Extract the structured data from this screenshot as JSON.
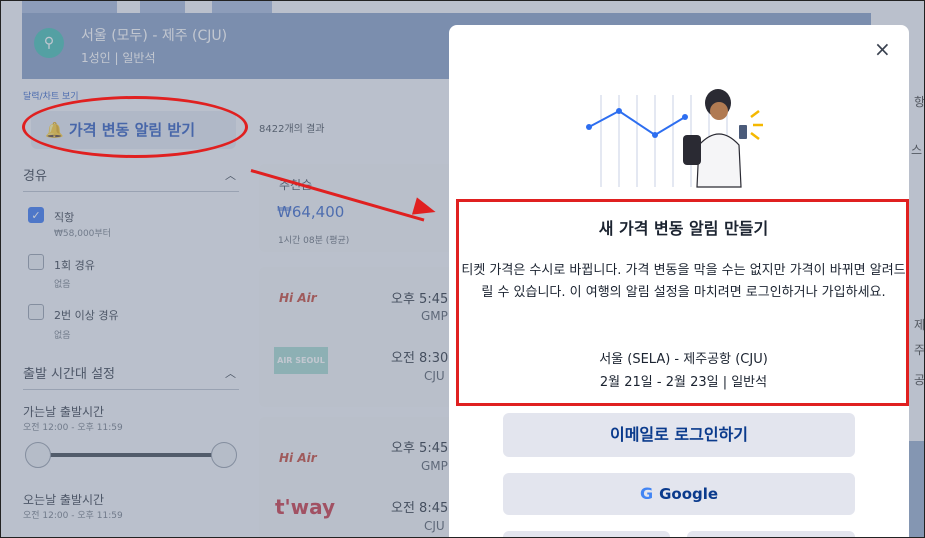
{
  "search": {
    "route": "서울 (모두) - 제주 (CJU)",
    "pax": "1성인 | 일반석",
    "calendar_link": "달력/차트 보기",
    "price_alert_button": "가격 변동 알림 받기",
    "results_count": "8422개의 결과"
  },
  "filters": {
    "stops_heading": "경유",
    "options": [
      {
        "label": "직항",
        "sub": "₩58,000부터",
        "checked": true
      },
      {
        "label": "1회 경유",
        "sub": "없음",
        "checked": false
      },
      {
        "label": "2번 이상 경유",
        "sub": "없음",
        "checked": false
      }
    ],
    "time_heading": "출발 시간대 설정",
    "outbound_label": "가는날 출발시간",
    "outbound_range": "오전 12:00 - 오후 11:59",
    "return_label": "오는날 출발시간",
    "return_range": "오전 12:00 - 오후 11:59"
  },
  "results": {
    "recommended_label": "추천순",
    "recommended_price": "₩64,400",
    "recommended_sub": "1시간 08분 (평균)",
    "cards": [
      {
        "airline1": "Hi Air",
        "time1": "오후 5:45",
        "ap1": "GMP",
        "airline2": "AIR SEOUL",
        "time2": "오전 8:30",
        "ap2": "CJU"
      },
      {
        "airline1": "Hi Air",
        "time1": "오후 5:45",
        "ap1": "GMP",
        "airline2": "t'way",
        "time2": "오전 8:45",
        "ap2": "CJU"
      }
    ]
  },
  "right_strip": {
    "t1": "항",
    "t2": "스",
    "t3": "제",
    "t4": "주",
    "t5": "공"
  },
  "modal": {
    "title": "새 가격 변동 알림 만들기",
    "body": "티켓 가격은 수시로 바뀝니다. 가격 변동을 막을 수는 없지만 가격이 바뀌면 알려드릴 수 있습니다. 이 여행의 알림 설정을 마치려면 로그인하거나 가입하세요.",
    "route": "서울 (SELA) - 제주공항 (CJU)",
    "dates": "2월 21일 - 2월 23일 | 일반석",
    "email_button": "이메일로 로그인하기",
    "google_button": "Google",
    "close_icon": "×"
  },
  "colors": {
    "accent": "#2c5cc4",
    "annotation": "#e02020",
    "teal": "#37b9ad"
  }
}
